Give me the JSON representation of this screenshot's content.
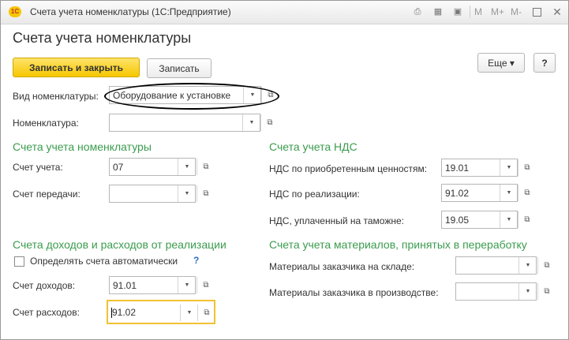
{
  "window": {
    "title": "Счета учета номенклатуры  (1С:Предприятие)",
    "logo_text": "1С",
    "m_labels": [
      "M",
      "M+",
      "M-"
    ]
  },
  "form": {
    "title": "Счета учета номенклатуры",
    "buttons": {
      "save_close": "Записать и закрыть",
      "save": "Записать",
      "more": "Еще",
      "help": "?"
    }
  },
  "fields": {
    "nomenclature_type": {
      "label": "Вид номенклатуры:",
      "value": "Оборудование к установке"
    },
    "nomenclature": {
      "label": "Номенклатура:",
      "value": ""
    }
  },
  "section_accounts": {
    "title": "Счета учета номенклатуры",
    "account": {
      "label": "Счет учета:",
      "value": "07"
    },
    "transfer": {
      "label": "Счет передачи:",
      "value": ""
    }
  },
  "section_vat": {
    "title": "Счета учета НДС",
    "acquired": {
      "label": "НДС по приобретенным ценностям:",
      "value": "19.01"
    },
    "sales": {
      "label": "НДС по реализации:",
      "value": "91.02"
    },
    "customs": {
      "label": "НДС, уплаченный на таможне:",
      "value": "19.05"
    }
  },
  "section_income": {
    "title": "Счета доходов и расходов от реализации",
    "auto_checkbox": "Определять счета автоматически",
    "auto_help": "?",
    "income": {
      "label": "Счет доходов:",
      "value": "91.01"
    },
    "expense": {
      "label": "Счет расходов:",
      "value": "91.02"
    }
  },
  "section_materials": {
    "title": "Счета учета материалов, принятых в переработку",
    "warehouse": {
      "label": "Материалы заказчика на складе:",
      "value": ""
    },
    "production": {
      "label": "Материалы заказчика в производстве:",
      "value": ""
    }
  },
  "icons": {
    "dropdown": "▼",
    "open": "⧉",
    "more_arrow": "▾"
  }
}
